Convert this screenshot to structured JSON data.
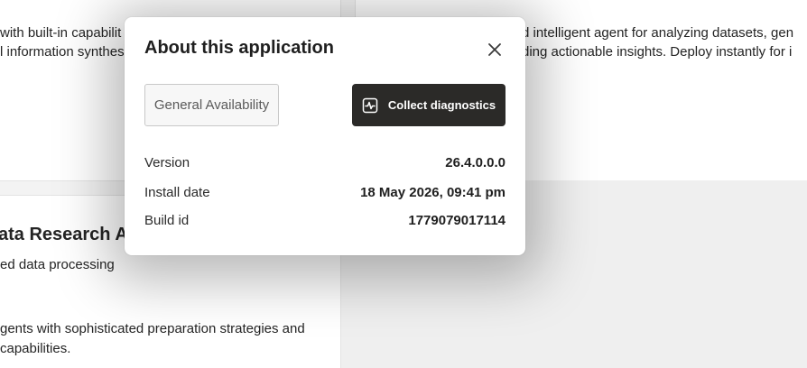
{
  "background": {
    "card_top_left": {
      "line1": "with built-in capabilit",
      "line2": "l information synthes"
    },
    "card_top_right": {
      "line1": "d intelligent agent for analyzing datasets, gen",
      "line2": "ding actionable insights. Deploy instantly for i"
    },
    "card_bottom_left": {
      "title": "ata Research A",
      "subtitle": "ed data processing",
      "desc_line1": "gents with sophisticated preparation strategies and",
      "desc_line2": " capabilities."
    }
  },
  "dialog": {
    "title": "About this application",
    "close_icon": "close-icon",
    "badge_label": "General Availability",
    "diagnostics_button": {
      "label": "Collect diagnostics",
      "icon": "activity-pulse-icon"
    },
    "info": [
      {
        "label": "Version",
        "value": "26.4.0.0.0"
      },
      {
        "label": "Install date",
        "value": "18 May 2026, 09:41 pm"
      },
      {
        "label": "Build id",
        "value": "1779079017114"
      }
    ]
  },
  "colors": {
    "primary_button_bg": "#2b2a28",
    "dialog_bg": "#ffffff",
    "page_bg": "#f3f3f3"
  }
}
